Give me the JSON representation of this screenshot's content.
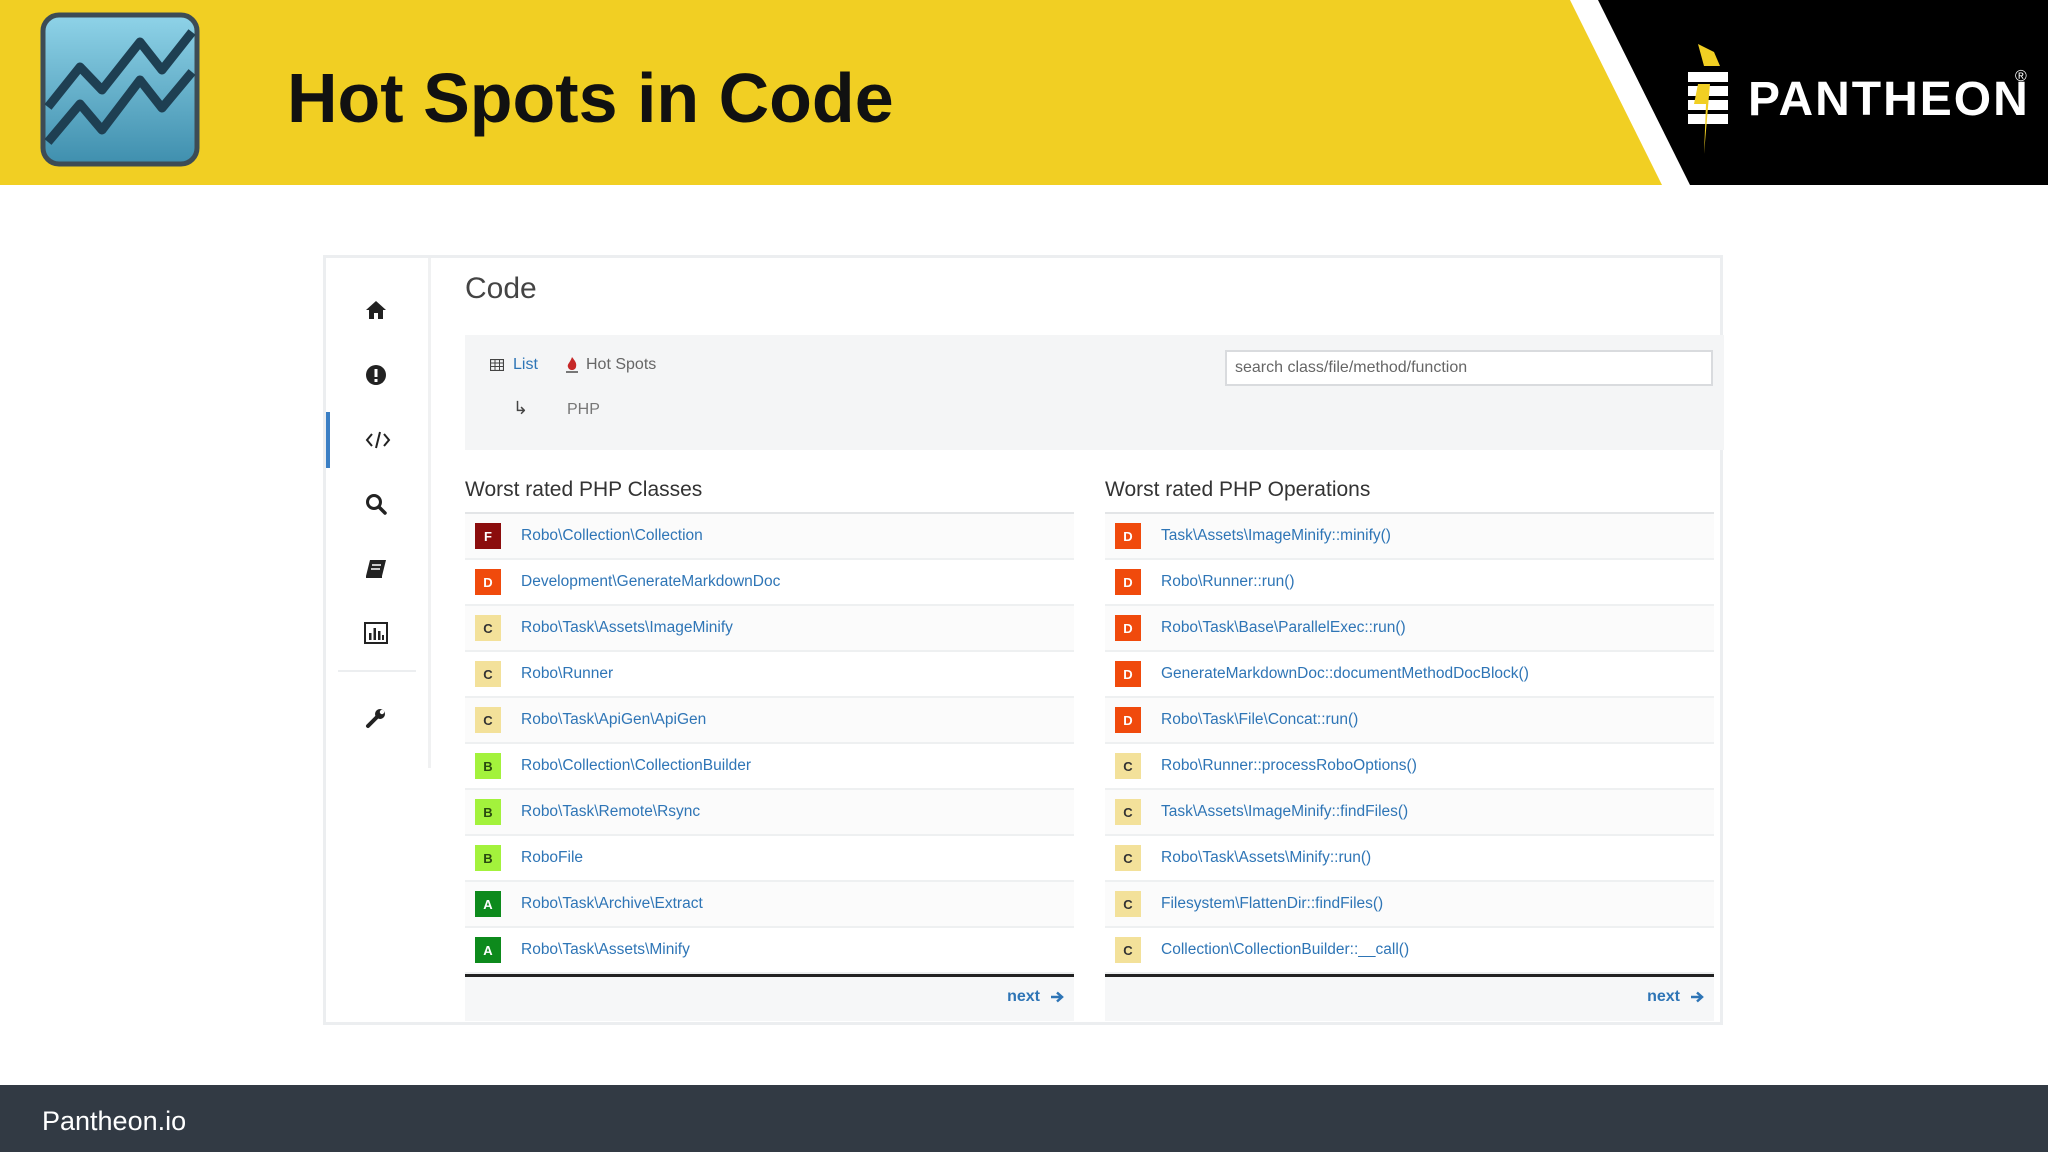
{
  "slide": {
    "title": "Hot Spots in Code"
  },
  "brand": {
    "name": "PANTHEON",
    "mark": "®"
  },
  "footer": {
    "text": "Pantheon.io"
  },
  "app": {
    "page_title": "Code",
    "sidebar": [
      {
        "icon": "home-icon",
        "active": false
      },
      {
        "icon": "alert-icon",
        "active": false
      },
      {
        "icon": "code-icon",
        "active": true
      },
      {
        "icon": "search-icon",
        "active": false
      },
      {
        "icon": "book-icon",
        "active": false
      },
      {
        "icon": "chart-icon",
        "active": false
      },
      {
        "icon": "wrench-icon",
        "active": false
      }
    ],
    "toolbar": {
      "list_label": "List",
      "hotspots_label": "Hot Spots",
      "sub_arrow": "↳",
      "language": "PHP",
      "search_placeholder": "search class/file/method/function"
    },
    "grade_colors": {
      "F": {
        "bg": "#8b0d0d",
        "fg": "#ffffff"
      },
      "D": {
        "bg": "#f04a0c",
        "fg": "#ffffff"
      },
      "C": {
        "bg": "#f3e19a",
        "fg": "#333333"
      },
      "B": {
        "bg": "#a3f23c",
        "fg": "#2a4a10"
      },
      "A": {
        "bg": "#0d8a1c",
        "fg": "#ffffff"
      }
    },
    "classes": {
      "title": "Worst rated PHP Classes",
      "next_label": "next",
      "rows": [
        {
          "grade": "F",
          "name": "Robo\\Collection\\Collection"
        },
        {
          "grade": "D",
          "name": "Development\\GenerateMarkdownDoc"
        },
        {
          "grade": "C",
          "name": "Robo\\Task\\Assets\\ImageMinify"
        },
        {
          "grade": "C",
          "name": "Robo\\Runner"
        },
        {
          "grade": "C",
          "name": "Robo\\Task\\ApiGen\\ApiGen"
        },
        {
          "grade": "B",
          "name": "Robo\\Collection\\CollectionBuilder"
        },
        {
          "grade": "B",
          "name": "Robo\\Task\\Remote\\Rsync"
        },
        {
          "grade": "B",
          "name": "RoboFile"
        },
        {
          "grade": "A",
          "name": "Robo\\Task\\Archive\\Extract"
        },
        {
          "grade": "A",
          "name": "Robo\\Task\\Assets\\Minify"
        }
      ]
    },
    "operations": {
      "title": "Worst rated PHP Operations",
      "next_label": "next",
      "rows": [
        {
          "grade": "D",
          "name": "Task\\Assets\\ImageMinify::minify()"
        },
        {
          "grade": "D",
          "name": "Robo\\Runner::run()"
        },
        {
          "grade": "D",
          "name": "Robo\\Task\\Base\\ParallelExec::run()"
        },
        {
          "grade": "D",
          "name": "GenerateMarkdownDoc::documentMethodDocBlock()"
        },
        {
          "grade": "D",
          "name": "Robo\\Task\\File\\Concat::run()"
        },
        {
          "grade": "C",
          "name": "Robo\\Runner::processRoboOptions()"
        },
        {
          "grade": "C",
          "name": "Task\\Assets\\ImageMinify::findFiles()"
        },
        {
          "grade": "C",
          "name": "Robo\\Task\\Assets\\Minify::run()"
        },
        {
          "grade": "C",
          "name": "Filesystem\\FlattenDir::findFiles()"
        },
        {
          "grade": "C",
          "name": "Collection\\CollectionBuilder::__call()"
        }
      ]
    }
  }
}
